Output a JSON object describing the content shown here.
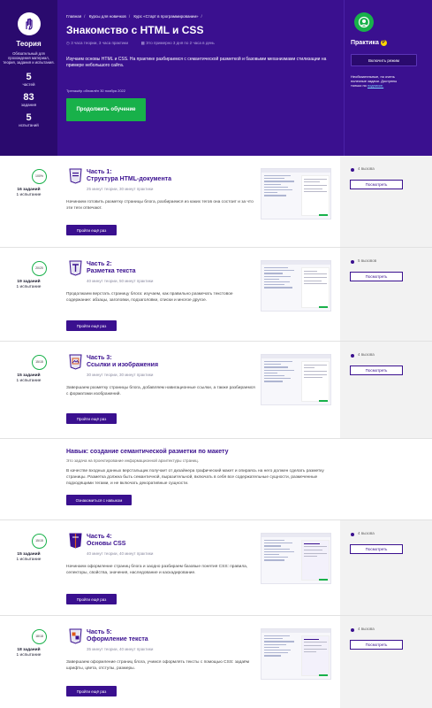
{
  "theory": {
    "title": "Теория",
    "description": "Обязательный для прохождения материал, теория, задания и испытания.",
    "stats": [
      {
        "value": "5",
        "label": "частей"
      },
      {
        "value": "83",
        "label": "задания"
      },
      {
        "value": "5",
        "label": "испытаний"
      }
    ]
  },
  "breadcrumbs": [
    "Главная",
    "Курсы для новичков",
    "Курс «Старт в программировании»"
  ],
  "course": {
    "title": "Знакомство с HTML и CSS",
    "hours": "3 часа теории, 3 часа практики",
    "pace": "Это примерно 3 дня по 2 часа в день",
    "intro": "Изучаем основы HTML и CSS. На практике разбираемся с семантической разметкой и базовыми механизмами стилизации на примере небольшого сайта.",
    "updated": "Тренажёр обновлён 30 ноября 2022",
    "continue_label": "Продолжить обучение"
  },
  "practice": {
    "title": "Практика",
    "badge": "P",
    "enable_label": "Включить режим",
    "note": "Необязательные, но очень полезные задачи. Доступны только по",
    "note_link": "подписке."
  },
  "chapters": [
    {
      "node": "100%",
      "tasks": "16 заданий",
      "tests": "1 испытание",
      "num": "Часть 1:",
      "name": "Структура HTML-документа",
      "meta": "25 минут теории, 30 минут практики",
      "desc": "Начинаем готовить разметку страницы блога, разбираемся из каких тегов она состоит и за что эти теги отвечают.",
      "retry": "Пройти ещё раз",
      "count": "4 вызова",
      "view": "Посмотреть"
    },
    {
      "node": "20/20",
      "tasks": "19 заданий",
      "tests": "1 испытание",
      "num": "Часть 2:",
      "name": "Разметка текста",
      "meta": "40 минут теории, 50 минут практики",
      "desc": "Продолжаем верстать страницу блога: изучаем, как правильно размечать текстовое содержание: абзацы, заголовки, подзаголовки, списки и многое другое.",
      "retry": "Пройти ещё раз",
      "count": "5 вызовов",
      "view": "Посмотреть"
    },
    {
      "node": "15/15",
      "tasks": "15 заданий",
      "tests": "1 испытание",
      "num": "Часть 3:",
      "name": "Ссылки и изображения",
      "meta": "30 минут теории, 30 минут практики",
      "desc": "Завершаем разметку страницы блога, добавляем навигационные ссылки, а также разбираемся с форматами изображений.",
      "retry": "Пройти ещё раз",
      "count": "4 вызова",
      "view": "Посмотреть"
    },
    {
      "node": "15/15",
      "tasks": "15 заданий",
      "tests": "1 испытание",
      "num": "Часть 4:",
      "name": "Основы CSS",
      "meta": "40 минут теории, 40 минут практики",
      "desc": "Начинаем оформление страниц блога и заодно разбираем базовые понятия CSS: правила, селекторы, свойства, значения, наследование и каскадирование.",
      "retry": "Пройти ещё раз",
      "count": "4 вызова",
      "view": "Посмотреть"
    },
    {
      "node": "18/18",
      "tasks": "18 заданий",
      "tests": "1 испытание",
      "num": "Часть 5:",
      "name": "Оформление текста",
      "meta": "35 минут теории, 40 минут практики",
      "desc": "Завершаем оформление страниц блога, учимся оформлять тексты с помощью CSS: задаём шрифты, цвета, отступы, размеры.",
      "retry": "Пройти ещё раз",
      "count": "4 вызова",
      "view": "Посмотреть"
    }
  ],
  "skill": {
    "title": "Навык: создание семантической разметки по макету",
    "subtitle": "Это задача на проектирование информационной архитектуры страниц.",
    "desc": "В качестве входных данных верстальщик получает от дизайнера графический макет и опираясь на него должен сделать разметку страницы. Разметка должна быть семантичной, выразительной, включать в себя все содержательные сущности, размеченные подходящими тегами, и не включать декоративные сущности.",
    "button": "Ознакомиться с навыком"
  }
}
